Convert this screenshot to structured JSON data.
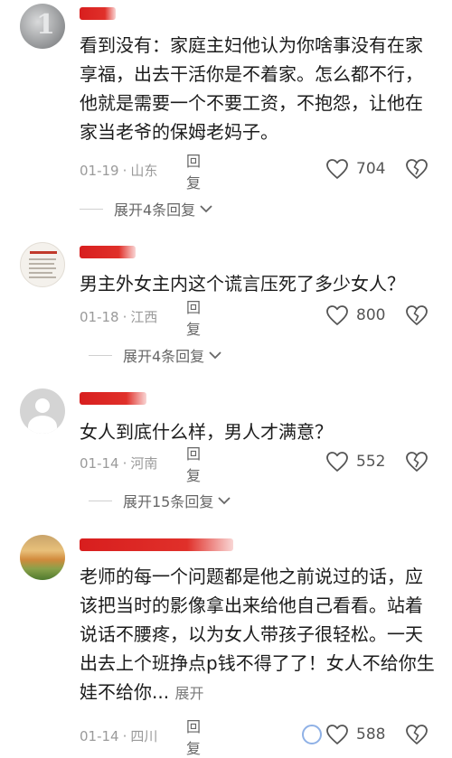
{
  "comments": [
    {
      "text": "看到没有：家庭主妇他认为你啥事没有在家享福，出去干活你是不着家。怎么都不行，他就是需要一个不要工资，不抱怨，让他在家当老爷的保姆老妈子。",
      "date": "01-19",
      "location": "山东",
      "reply_label": "回复",
      "likes": "704",
      "expand_label": "展开4条回复"
    },
    {
      "text": "男主外女主内这个谎言压死了多少女人？",
      "date": "01-18",
      "location": "江西",
      "reply_label": "回复",
      "likes": "800",
      "expand_label": "展开4条回复"
    },
    {
      "text": "女人到底什么样，男人才满意？",
      "date": "01-14",
      "location": "河南",
      "reply_label": "回复",
      "likes": "552",
      "expand_label": "展开15条回复"
    },
    {
      "text": "老师的每一个问题都是他之前说过的话，应该把当时的影像拿出来给他自己看看。站着说话不腰疼，以为女人带孩子很轻松。一天出去上个班挣点p钱不得了了！女人不给你生娃不给你...",
      "inline_expand": "展开",
      "date": "01-14",
      "location": "四川",
      "reply_label": "回复",
      "likes": "588"
    }
  ],
  "colors": {
    "username_redaction": "#e0302a",
    "meta_text": "#9a9a9a",
    "body_text": "#1c1c1c"
  }
}
